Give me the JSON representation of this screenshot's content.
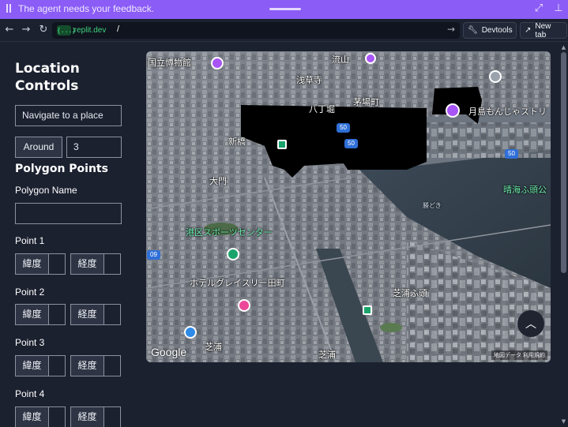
{
  "feedback_bar": {
    "message": "The agent needs your feedback.",
    "color": "#8b5cf6"
  },
  "browser": {
    "domain": ".replit.dev",
    "logo_text": "{...}",
    "path": "/",
    "devtools_label": "Devtools",
    "new_tab_label": "New tab"
  },
  "panel": {
    "title": "Location Controls",
    "navigate_placeholder": "Navigate to a place",
    "around_label": "Around",
    "around_value": "3",
    "polygon_section_title": "Polygon Points",
    "polygon_name_label": "Polygon Name",
    "polygon_name_value": "",
    "latitude_label": "緯度",
    "longitude_label": "経度",
    "points": [
      {
        "label": "Point 1"
      },
      {
        "label": "Point 2"
      },
      {
        "label": "Point 3"
      },
      {
        "label": "Point 4"
      }
    ]
  },
  "map": {
    "google_logo": "Google",
    "attribution": "地図データ  利用規約",
    "labels": {
      "museum": "国立博物館",
      "asakusa": "浅草寺",
      "nagareyama": "流山",
      "hatchobori": "八丁堀",
      "kayabacho": "茅場町",
      "tsukishima": "月島もんじゃストリ",
      "harumi": "晴海ふ頭公",
      "kachidoki": "勝どき",
      "minato_sports": "港区スポーツセンター",
      "hotel": "ホテルグレイスリー田町",
      "shibaura": "芝浦",
      "shibaura2": "芝浦",
      "shibaura_island": "芝浦ふ頭",
      "shinbashi": "新橋",
      "ohmon": "大門"
    },
    "highway_badges": [
      "50",
      "50",
      "50",
      "09"
    ]
  }
}
